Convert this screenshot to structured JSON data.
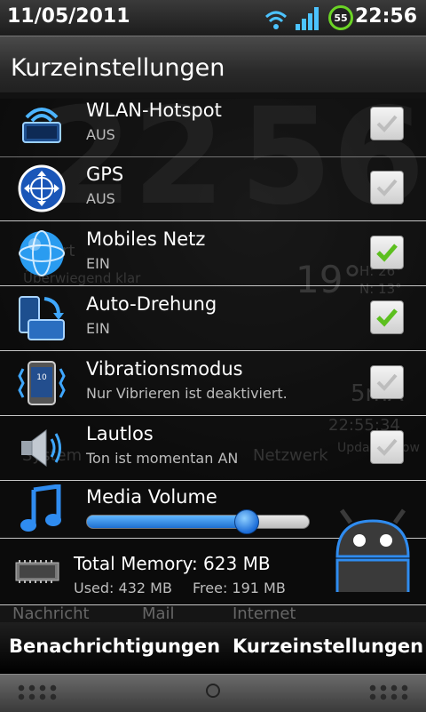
{
  "status_bar": {
    "date": "11/05/2011",
    "time": "22:56",
    "battery_level": "55",
    "icons": [
      "wifi-icon",
      "signal-icon",
      "battery-icon"
    ]
  },
  "wallpaper": {
    "clock_hour": "22",
    "clock_minute": "56",
    "location": "Vorort",
    "weather": "Überwiegend klar",
    "temperature": "19°",
    "high": "H: 26°",
    "low": "N: 13°",
    "current": "5mA",
    "updated_time": "22:55:34",
    "updated_label": "Updated now",
    "widget_labels": [
      "System",
      "Netzwerk"
    ],
    "dock": [
      "Nachricht",
      "Mail",
      "Internet"
    ]
  },
  "header": {
    "title": "Kurzeinstellungen"
  },
  "settings": [
    {
      "title": "WLAN-Hotspot",
      "subtitle": "AUS",
      "checked": false,
      "icon": "wifi-hotspot-icon"
    },
    {
      "title": "GPS",
      "subtitle": "AUS",
      "checked": false,
      "icon": "gps-icon"
    },
    {
      "title": "Mobiles Netz",
      "subtitle": "EIN",
      "checked": true,
      "icon": "mobile-network-icon"
    },
    {
      "title": "Auto-Drehung",
      "subtitle": "EIN",
      "checked": true,
      "icon": "auto-rotate-icon"
    },
    {
      "title": "Vibrationsmodus",
      "subtitle": "Nur Vibrieren ist deaktiviert.",
      "checked": false,
      "icon": "vibrate-icon"
    },
    {
      "title": "Lautlos",
      "subtitle": "Ton ist momentan AN",
      "checked": false,
      "icon": "speaker-icon"
    }
  ],
  "media_volume": {
    "title": "Media Volume",
    "level": 0.72
  },
  "memory": {
    "title": "Total Memory: 623 MB",
    "used": "Used: 432 MB",
    "free": "Free: 191 MB"
  },
  "tabs": {
    "notifications": "Benachrichtigungen",
    "quick_settings": "Kurzeinstellungen"
  },
  "colors": {
    "check_green": "#5cbf1e",
    "slider_blue": "#1e6fd0",
    "battery_green": "#6bd425"
  }
}
